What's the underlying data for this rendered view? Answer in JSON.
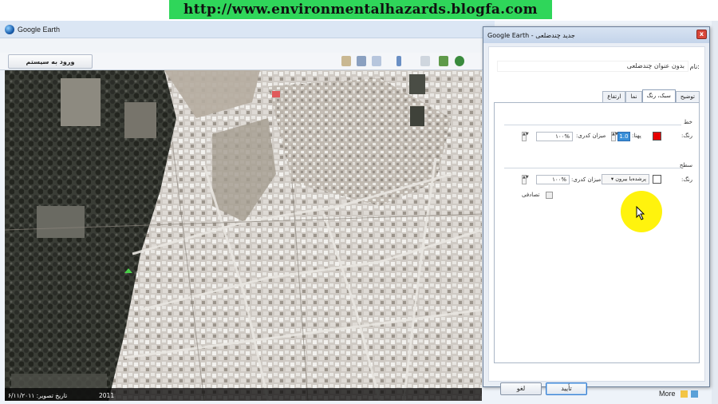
{
  "banner": {
    "url": "http://www.environmentalhazards.blogfa.com"
  },
  "app": {
    "title": "Google Earth",
    "signin_label": "ورود به سیستم",
    "more_label": "More",
    "map": {
      "imagery_date": "تاریخ تصویر: ۶/۱۱/۲۰۱۱",
      "year": "2011",
      "coords": "",
      "watermark": "",
      "watermark2": ""
    }
  },
  "dialog": {
    "title": "Google Earth - جدید چندضلعی",
    "close_glyph": "x",
    "name_label": "نام:",
    "name_value": "بدون عنوان چندضلعی",
    "tabs": [
      {
        "label": "توضیح"
      },
      {
        "label": "سبک، رنگ"
      },
      {
        "label": "نما"
      },
      {
        "label": "ارتفاع"
      }
    ],
    "line_group": {
      "title": "خط",
      "color_label": "رنگ:",
      "color": "#e60000",
      "width_label": "پهنا:",
      "width_value": "1.0",
      "opacity_label": "میزان کدری:",
      "opacity_value": "۱۰۰%"
    },
    "area_group": {
      "title": "سطح",
      "color_label": "رنگ:",
      "color": "#ffffff",
      "fill_value": "پرشده‌با بیرون",
      "opacity_label": "میزان کدری:",
      "opacity_value": "۱۰۰%",
      "random_label": "تصادفی"
    },
    "ok_label": "تأیید",
    "cancel_label": "لغو"
  }
}
